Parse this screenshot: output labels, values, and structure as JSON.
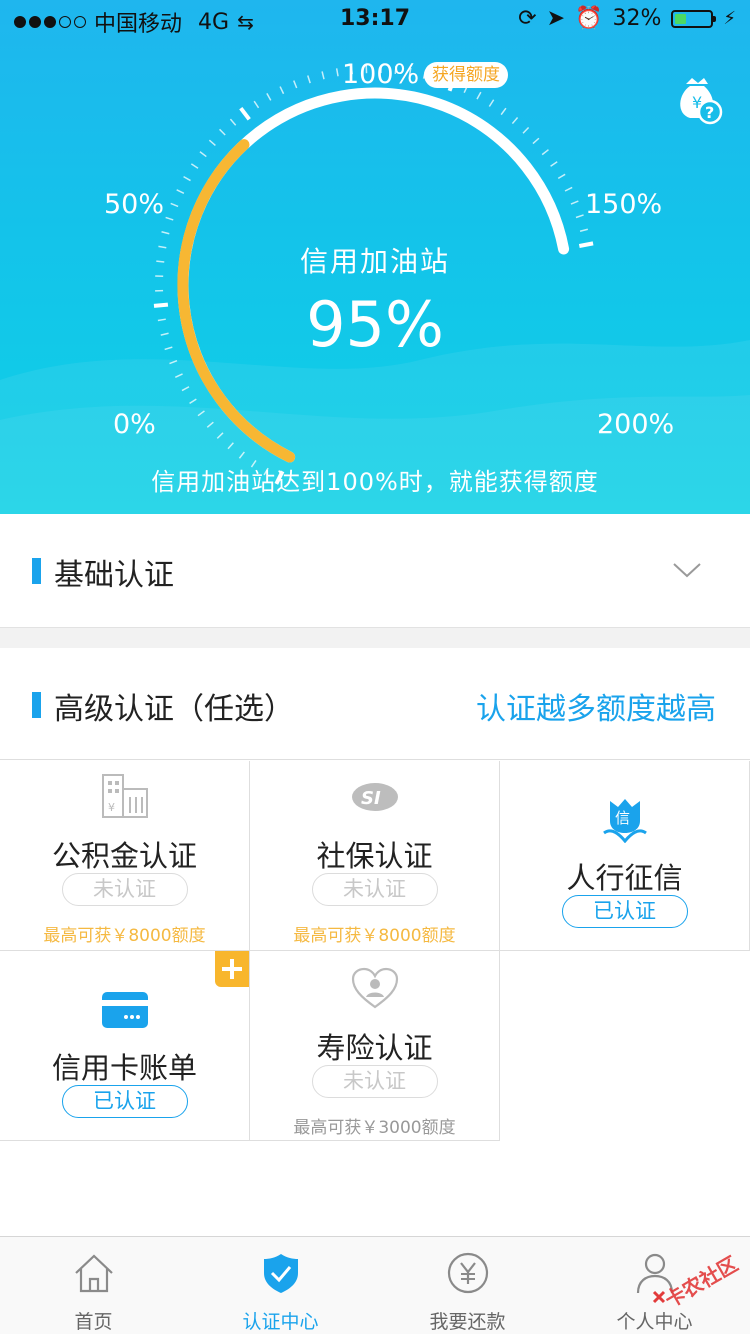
{
  "status_bar": {
    "carrier": "中国移动",
    "network": "4G",
    "time": "13:17",
    "battery": "32%",
    "signal_bars": 3,
    "battery_level": 0.32
  },
  "hero": {
    "badge": "获得额度",
    "gauge_labels": {
      "p0": "0%",
      "p50": "50%",
      "p100": "100%",
      "p150": "150%",
      "p200": "200%"
    },
    "title": "信用加油站",
    "value": "95%",
    "progress_fraction": 0.475,
    "note": "信用加油站达到100%时，就能获得额度",
    "colors": {
      "progress": "#f7b733",
      "track": "#ffffff",
      "background": "#15bfeb"
    }
  },
  "basic_section": {
    "title": "基础认证"
  },
  "advanced_section": {
    "title": "高级认证（任选）",
    "link": "认证越多额度越高"
  },
  "cards": {
    "housing_fund": {
      "name": "公积金认证",
      "status": "未认证",
      "hint": "最高可获￥8000额度",
      "icon": "building-icon"
    },
    "social_security": {
      "name": "社保认证",
      "status": "未认证",
      "hint": "最高可获￥8000额度",
      "icon": "social-security-logo-icon"
    },
    "credit_report": {
      "name": "人行征信",
      "status": "已认证",
      "icon": "credit-flower-icon"
    },
    "credit_card_bill": {
      "name": "信用卡账单",
      "status": "已认证",
      "icon": "credit-card-icon"
    },
    "life_insurance": {
      "name": "寿险认证",
      "status": "未认证",
      "hint": "最高可获￥3000额度",
      "icon": "heart-person-icon"
    }
  },
  "tabbar": {
    "tabs": [
      {
        "label": "首页",
        "icon": "home-icon"
      },
      {
        "label": "认证中心",
        "icon": "shield-check-icon"
      },
      {
        "label": "我要还款",
        "icon": "yuan-circle-icon"
      },
      {
        "label": "个人中心",
        "icon": "person-icon"
      }
    ],
    "active_index": 1
  },
  "watermark": {
    "text": "卡农社区"
  },
  "accent": "#1aa3ec"
}
